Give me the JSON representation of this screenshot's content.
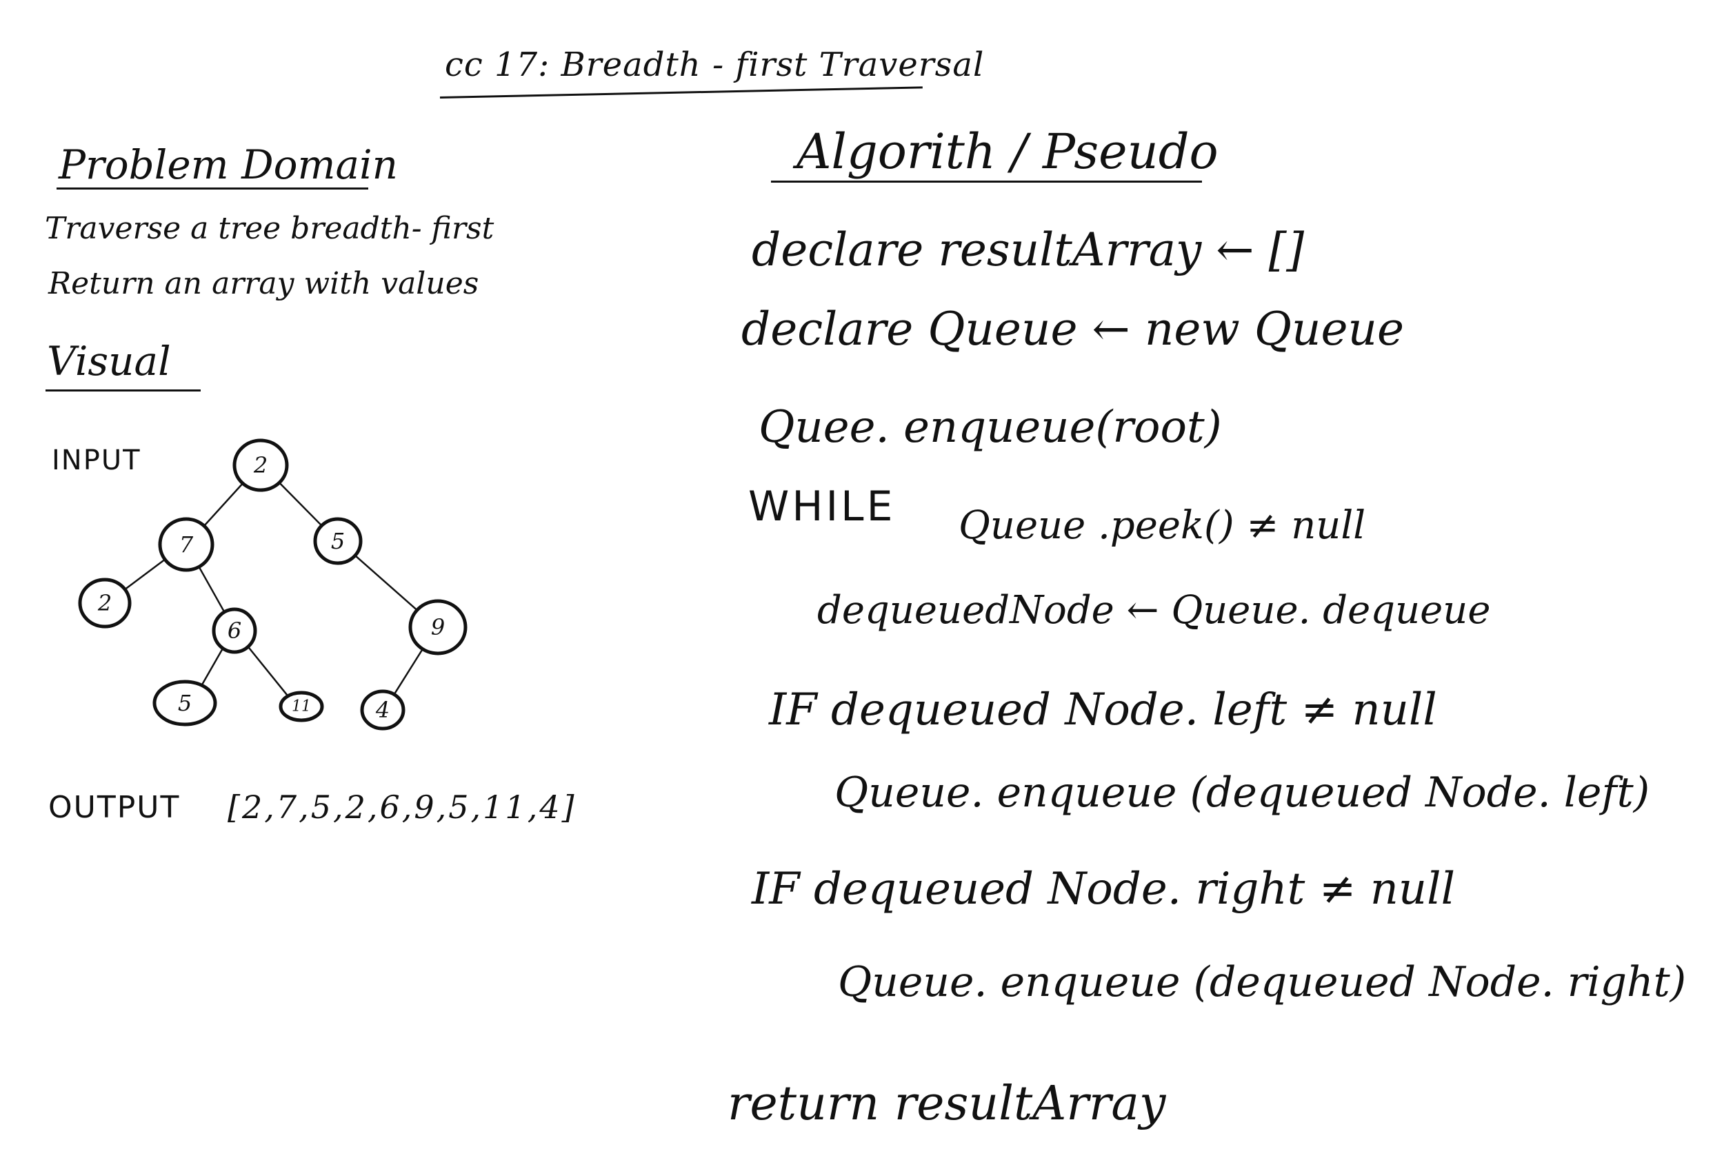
{
  "title": "cc 17: Breadth - first Traversal",
  "problem_domain": {
    "heading": "Problem Domain",
    "lines": [
      "Traverse a tree breadth- first",
      "Return an array with values"
    ]
  },
  "visual": {
    "heading": "Visual",
    "input_label": "INPUT",
    "output_label": "OUTPUT",
    "output_value": "[2,7,5,2,6,9,5,11,4]",
    "tree": {
      "nodes": [
        {
          "id": "n-root-2",
          "label": "2"
        },
        {
          "id": "n-7",
          "label": "7"
        },
        {
          "id": "n-5-top",
          "label": "5"
        },
        {
          "id": "n-2-leaf",
          "label": "2"
        },
        {
          "id": "n-6",
          "label": "6"
        },
        {
          "id": "n-9",
          "label": "9"
        },
        {
          "id": "n-5-leaf",
          "label": "5"
        },
        {
          "id": "n-11",
          "label": "11"
        },
        {
          "id": "n-4",
          "label": "4"
        }
      ],
      "edges": [
        [
          "n-root-2",
          "n-7"
        ],
        [
          "n-root-2",
          "n-5-top"
        ],
        [
          "n-7",
          "n-2-leaf"
        ],
        [
          "n-7",
          "n-6"
        ],
        [
          "n-5-top",
          "n-9"
        ],
        [
          "n-6",
          "n-5-leaf"
        ],
        [
          "n-6",
          "n-11"
        ],
        [
          "n-9",
          "n-4"
        ]
      ]
    }
  },
  "algorithm": {
    "heading": "Algorith / Pseudo",
    "lines": [
      "declare resultArray ← []",
      "declare Queue ← new Queue",
      "Quee. enqueue(root)",
      "WHILE",
      "Queue .peek() ≠ null",
      "dequeuedNode ← Queue. dequeue",
      "IF dequeued Node. left ≠ null",
      "Queue. enqueue (dequeued Node. left)",
      "IF dequeued Node. right ≠ null",
      "Queue. enqueue (dequeued Node. right)",
      "return resultArray"
    ]
  }
}
